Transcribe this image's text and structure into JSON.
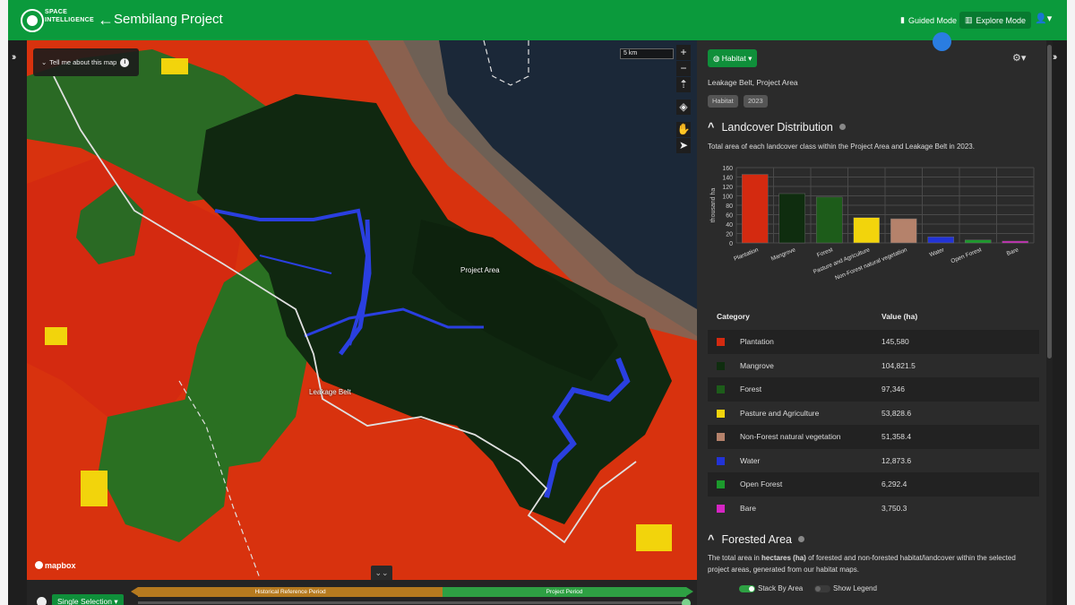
{
  "brand": {
    "line1": "SPACE",
    "line2": "INTELLIGENCE"
  },
  "header": {
    "back_icon": "arrow-left-icon",
    "title": "Sembilang Project",
    "guided_mode": "Guided Mode",
    "explore_mode": "Explore Mode",
    "user_icon": "user-icon"
  },
  "map": {
    "tell_me": "Tell me about this map",
    "scale": "5 km",
    "label_project_area": "Project Area",
    "label_leakage_belt": "Leakage Belt",
    "attribution": "mapbox"
  },
  "timeline": {
    "selection": "Single Selection",
    "historical": "Historical Reference Period",
    "project": "Project Period"
  },
  "panel": {
    "layer": "Habitat",
    "context": "Leakage Belt, Project Area",
    "tags": [
      "Habitat",
      "2023"
    ],
    "landcover_title": "Landcover Distribution",
    "landcover_desc": "Total area of each landcover class within the Project Area and Leakage Belt in 2023.",
    "table_headers": {
      "category": "Category",
      "value": "Value (ha)"
    },
    "rows": [
      {
        "category": "Plantation",
        "value": "145,580",
        "color": "#d42a10"
      },
      {
        "category": "Mangrove",
        "value": "104,821.5",
        "color": "#0f2d0f"
      },
      {
        "category": "Forest",
        "value": "97,346",
        "color": "#1d5c1a"
      },
      {
        "category": "Pasture and Agriculture",
        "value": "53,828.6",
        "color": "#f2d40c"
      },
      {
        "category": "Non-Forest natural vegetation",
        "value": "51,358.4",
        "color": "#b5826b"
      },
      {
        "category": "Water",
        "value": "12,873.6",
        "color": "#2233d6"
      },
      {
        "category": "Open Forest",
        "value": "6,292.4",
        "color": "#1c9a2c"
      },
      {
        "category": "Bare",
        "value": "3,750.3",
        "color": "#d625c4"
      }
    ],
    "forested_title": "Forested Area",
    "forested_desc_pre": "The total area in ",
    "forested_desc_bold": "hectares (ha)",
    "forested_desc_post": " of forested and non-forested habitat/landcover within the selected project areas, generated from our habitat maps.",
    "stack_by_area": "Stack By Area",
    "show_legend": "Show Legend"
  },
  "chart_data": {
    "type": "bar",
    "categories": [
      "Plantation",
      "Mangrove",
      "Forest",
      "Pasture and Agriculture",
      "Non-Forest natural vegetation",
      "Water",
      "Open Forest",
      "Bare"
    ],
    "values": [
      145.58,
      104.82,
      97.35,
      53.83,
      51.36,
      12.87,
      6.29,
      3.75
    ],
    "colors": [
      "#d42a10",
      "#0f2d0f",
      "#1d5c1a",
      "#f2d40c",
      "#b5826b",
      "#2233d6",
      "#1c9a2c",
      "#d625c4"
    ],
    "ylabel": "thousand ha",
    "ylim": [
      0,
      160
    ],
    "yticks": [
      0,
      20,
      40,
      60,
      80,
      100,
      120,
      140,
      160
    ],
    "ytick_labels": [
      "0",
      "20",
      "40",
      "60",
      "80",
      "100",
      "120",
      "140",
      "160"
    ],
    "grid": true
  }
}
